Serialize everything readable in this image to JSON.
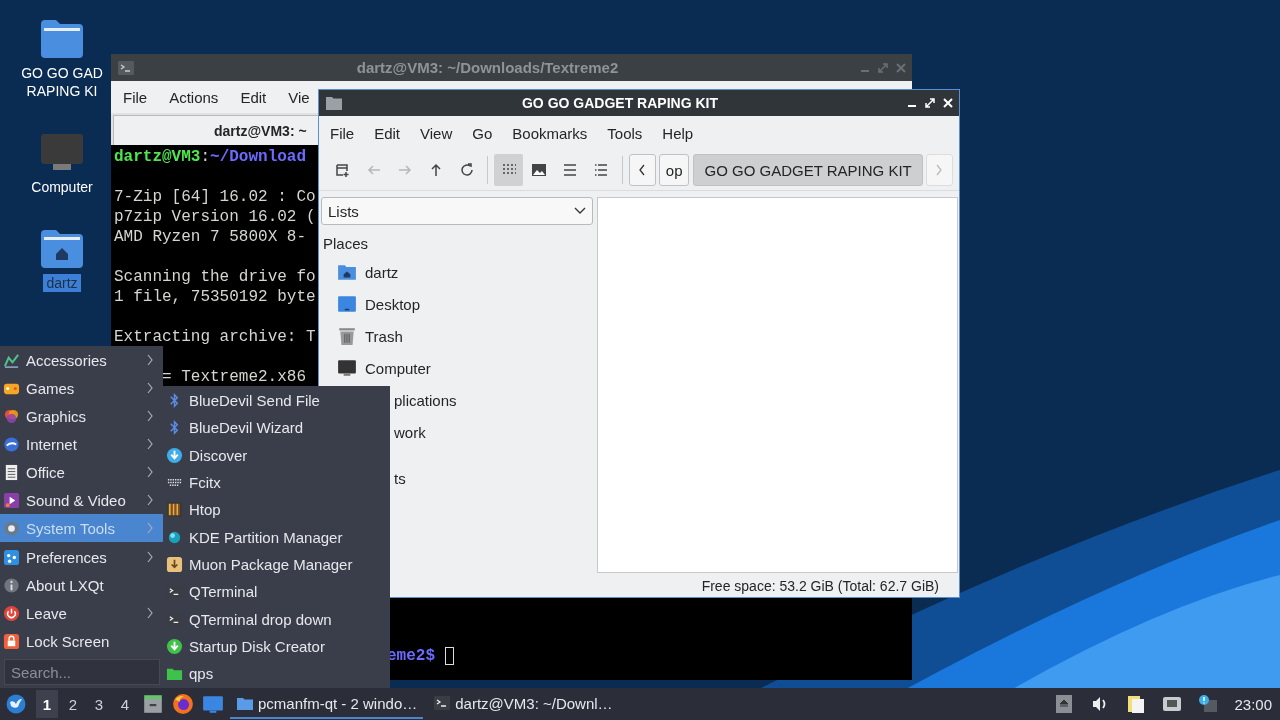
{
  "desktop": {
    "icons": [
      {
        "kind": "folder",
        "label_lines": [
          "GO GO GAD",
          "RAPING KI"
        ],
        "selected": false
      },
      {
        "kind": "computer",
        "label_lines": [
          "Computer"
        ],
        "selected": false
      },
      {
        "kind": "home",
        "label_lines": [
          "dartz"
        ],
        "selected": true
      }
    ]
  },
  "terminal": {
    "title": "dartz@VM3: ~/Downloads/Textreme2",
    "menu": [
      "File",
      "Actions",
      "Edit",
      "Vie"
    ],
    "tab": "dartz@VM3: ~",
    "lines": [
      {
        "kind": "prompt",
        "space_before": false,
        "parts": [
          {
            "kind": "user",
            "text": "dartz@VM3"
          },
          {
            "kind": "plain",
            "text": ":"
          },
          {
            "kind": "path",
            "text": "~/Download"
          }
        ]
      },
      {
        "kind": "output",
        "space_before": true,
        "text": "7-Zip [64] 16.02 : Co"
      },
      {
        "kind": "output",
        "space_before": false,
        "text": "p7zip Version 16.02 ("
      },
      {
        "kind": "output",
        "space_before": false,
        "text": "AMD Ryzen 7 5800X 8-"
      },
      {
        "kind": "output",
        "space_before": true,
        "text": "Scanning the drive fo"
      },
      {
        "kind": "output",
        "space_before": false,
        "text": "1 file, 75350192 byte"
      },
      {
        "kind": "output",
        "space_before": true,
        "text": "Extracting archive: T"
      },
      {
        "kind": "covered_start",
        "space_before": true,
        "text": "= Textreme2.x86"
      }
    ],
    "bottom_line": "eme2$"
  },
  "file_manager": {
    "title": "GO GO GADGET RAPING KIT",
    "menu": [
      "File",
      "Edit",
      "View",
      "Go",
      "Bookmarks",
      "Tools",
      "Help"
    ],
    "toolbar": [
      {
        "kind": "new-tab",
        "disabled": false
      },
      {
        "kind": "back",
        "disabled": true
      },
      {
        "kind": "forward",
        "disabled": true
      },
      {
        "kind": "up",
        "disabled": false
      },
      {
        "kind": "reload",
        "disabled": false
      }
    ],
    "views": [
      {
        "kind": "icons",
        "selected": true
      },
      {
        "kind": "thumbnails",
        "selected": false
      },
      {
        "kind": "compact",
        "selected": false
      },
      {
        "kind": "detailed",
        "selected": false
      }
    ],
    "path_bar": {
      "scroll_left_disabled": false,
      "scroll_right_disabled": true,
      "segments": [
        {
          "label": "op",
          "selected": false
        },
        {
          "label": "GO GO GADGET RAPING KIT",
          "selected": true
        }
      ]
    },
    "side_pane": {
      "mode": "Lists",
      "heading": "Places",
      "items": [
        {
          "kind": "home",
          "label": "dartz"
        },
        {
          "kind": "desktop",
          "label": "Desktop"
        },
        {
          "kind": "trash",
          "label": "Trash"
        },
        {
          "kind": "computer",
          "label": "Computer"
        },
        {
          "kind": "covered",
          "label": "plications"
        },
        {
          "kind": "covered",
          "label": "work"
        }
      ],
      "heading_2": "ts"
    },
    "status": "Free space: 53.2 GiB (Total: 62.7 GiB)"
  },
  "app_menu": {
    "items": [
      {
        "kind": "accessories",
        "label": "Accessories",
        "submenu": true,
        "selected": false
      },
      {
        "kind": "games",
        "label": "Games",
        "submenu": true,
        "selected": false
      },
      {
        "kind": "graphics",
        "label": "Graphics",
        "submenu": true,
        "selected": false
      },
      {
        "kind": "internet",
        "label": "Internet",
        "submenu": true,
        "selected": false
      },
      {
        "kind": "office",
        "label": "Office",
        "submenu": true,
        "selected": false
      },
      {
        "kind": "media",
        "label": "Sound & Video",
        "submenu": true,
        "selected": false
      },
      {
        "kind": "system",
        "label": "System Tools",
        "submenu": true,
        "selected": true
      },
      {
        "kind": "preferences",
        "label": "Preferences",
        "submenu": true,
        "selected": false
      },
      {
        "kind": "about",
        "label": "About LXQt",
        "submenu": false,
        "selected": false
      },
      {
        "kind": "leave",
        "label": "Leave",
        "submenu": true,
        "selected": false
      },
      {
        "kind": "lock",
        "label": "Lock Screen",
        "submenu": false,
        "selected": false
      }
    ],
    "search": {
      "placeholder": "Search..."
    },
    "submenu": [
      {
        "kind": "bluetooth",
        "label": "BlueDevil Send File"
      },
      {
        "kind": "bluetooth",
        "label": "BlueDevil Wizard"
      },
      {
        "kind": "discover",
        "label": "Discover"
      },
      {
        "kind": "keyboard",
        "label": "Fcitx"
      },
      {
        "kind": "htop",
        "label": "Htop"
      },
      {
        "kind": "partition",
        "label": "KDE Partition Manager"
      },
      {
        "kind": "package",
        "label": "Muon Package Manager"
      },
      {
        "kind": "terminal",
        "label": "QTerminal"
      },
      {
        "kind": "terminal",
        "label": "QTerminal drop down"
      },
      {
        "kind": "startup",
        "label": "Startup Disk Creator"
      },
      {
        "kind": "qps",
        "label": "qps"
      }
    ]
  },
  "taskbar": {
    "workspaces": [
      {
        "label": "1",
        "selected": true
      },
      {
        "label": "2",
        "selected": false
      },
      {
        "label": "3",
        "selected": false
      },
      {
        "label": "4",
        "selected": false
      }
    ],
    "launchers": [
      {
        "kind": "cabinet"
      },
      {
        "kind": "browser"
      },
      {
        "kind": "desktop"
      }
    ],
    "tasks": [
      {
        "kind": "folder",
        "label": "pcmanfm-qt - 2 windo…",
        "selected": true
      },
      {
        "kind": "terminal",
        "label": "dartz@VM3: ~/Downl…",
        "selected": false
      }
    ],
    "tray": [
      {
        "kind": "eject"
      },
      {
        "kind": "volume"
      },
      {
        "kind": "clipboard"
      },
      {
        "kind": "network"
      },
      {
        "kind": "notification"
      }
    ],
    "clock": "23:00"
  }
}
